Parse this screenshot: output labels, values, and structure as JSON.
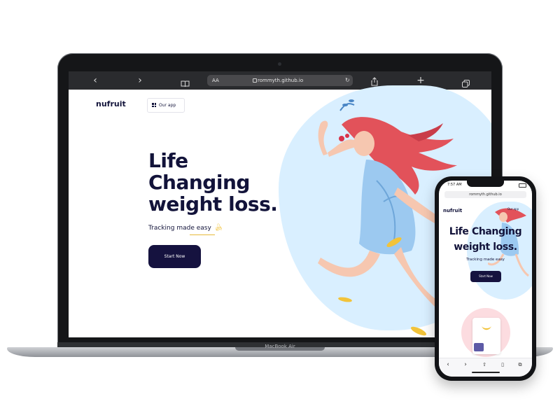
{
  "browser": {
    "url": "rommyth.github.io",
    "text_size_label": "AA",
    "back_icon": "chevron-left-icon",
    "forward_icon": "chevron-right-icon",
    "bookmarks_icon": "book-icon",
    "share_icon": "share-icon",
    "new_tab_icon": "plus-icon",
    "tabs_icon": "tabs-icon"
  },
  "site": {
    "logo": "nufruit",
    "nav_button_label": "Our app",
    "hero_lines": [
      "Life",
      "Changing",
      "weight loss."
    ],
    "subtitle": "Tracking made easy",
    "cta_label": "Start Now"
  },
  "device": {
    "laptop_label": "MacBook Air"
  },
  "phone": {
    "time": "7:57 AM",
    "url": "rommyth.github.io",
    "logo": "nufruit",
    "nav_button_label": "Our app",
    "hero_lines": [
      "Life Changing",
      "weight loss."
    ],
    "subtitle": "Tracking made easy",
    "cta_label": "Start Now"
  },
  "colors": {
    "brand_navy": "#15123f",
    "hero_bg": "#d9efff",
    "accent_banana": "#f2c33a"
  }
}
